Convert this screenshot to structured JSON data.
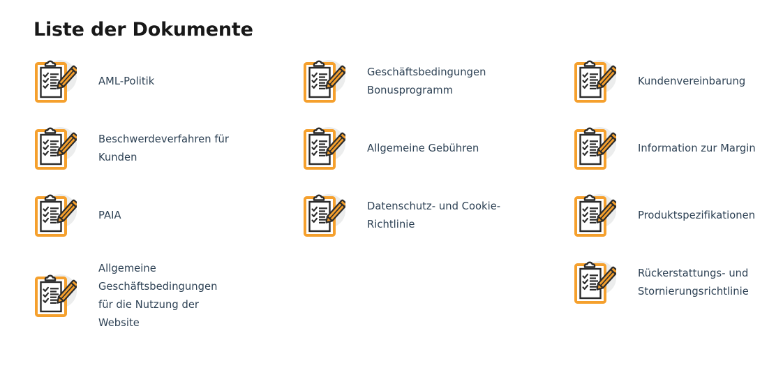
{
  "page": {
    "title": "Liste der Dokumente",
    "background_color": "#ffffff",
    "heading_color": "#181818",
    "link_color": "#2d4154",
    "icon_accent_color": "#f5a02d",
    "icon_outline_color": "#2b2b2b",
    "icon_circle_color": "#eceded",
    "icon_name": "clipboard-checklist-pencil-icon"
  },
  "columns": [
    {
      "id": "column-1",
      "items": [
        {
          "icon": "clipboard-checklist-pencil-icon",
          "label": "AML-Politik"
        },
        {
          "icon": "clipboard-checklist-pencil-icon",
          "label": "Beschwerdeverfahren für\nKunden"
        },
        {
          "icon": "clipboard-checklist-pencil-icon",
          "label": "PAIA"
        },
        {
          "icon": "clipboard-checklist-pencil-icon",
          "label": "Allgemeine\nGeschäftsbedingungen\nfür die Nutzung der\nWebsite"
        }
      ]
    },
    {
      "id": "column-2",
      "items": [
        {
          "icon": "clipboard-checklist-pencil-icon",
          "label": "Geschäftsbedingungen\nBonusprogramm"
        },
        {
          "icon": "clipboard-checklist-pencil-icon",
          "label": "Allgemeine Gebühren"
        },
        {
          "icon": "clipboard-checklist-pencil-icon",
          "label": "Datenschutz- und Cookie-\nRichtlinie"
        }
      ]
    },
    {
      "id": "column-3",
      "items": [
        {
          "icon": "clipboard-checklist-pencil-icon",
          "label": "Kundenvereinbarung"
        },
        {
          "icon": "clipboard-checklist-pencil-icon",
          "label": "Information zur Margin"
        },
        {
          "icon": "clipboard-checklist-pencil-icon",
          "label": "Produktspezifikationen"
        },
        {
          "icon": "clipboard-checklist-pencil-icon",
          "label": "Rückerstattungs- und\nStornierungsrichtlinie"
        }
      ]
    }
  ]
}
